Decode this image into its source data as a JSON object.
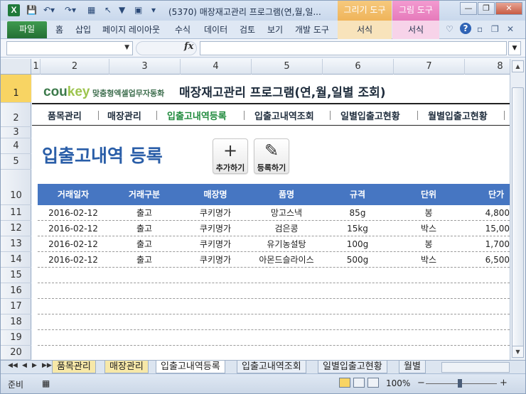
{
  "window": {
    "title": "(5370) 매장재고관리 프로그램(연,월,일...",
    "context_tools": [
      "그리기 도구",
      "그림 도구"
    ]
  },
  "ribbon": {
    "file_tab": "파일",
    "tabs": [
      "홈",
      "삽입",
      "페이지 레이아웃",
      "수식",
      "데이터",
      "검토",
      "보기",
      "개발 도구"
    ],
    "context_tabs": [
      "서식",
      "서식"
    ]
  },
  "formula_bar": {
    "fx_label": "fx",
    "name_box": "",
    "formula": ""
  },
  "columns": [
    "1",
    "2",
    "3",
    "4",
    "5",
    "6",
    "7",
    "8"
  ],
  "rows": [
    "1",
    "2",
    "3",
    "4",
    "5",
    "10",
    "11",
    "12",
    "13",
    "14",
    "15",
    "16",
    "17",
    "18",
    "19",
    "20"
  ],
  "sheet": {
    "brand": {
      "name_a": "cou",
      "name_b": "key",
      "subtitle": "맞춤형엑셀업무자동화"
    },
    "app_title": "매장재고관리 프로그램(연,월,일별 조회)",
    "menu": [
      "품목관리",
      "매장관리",
      "입출고내역등록",
      "입출고내역조회",
      "일별입출고현황",
      "월별입출고현황"
    ],
    "active_menu_index": 2,
    "page_title": "입출고내역 등록",
    "buttons": {
      "add": "추가하기",
      "register": "등록하기"
    },
    "table": {
      "headers": [
        "거래일자",
        "거래구분",
        "매장명",
        "품명",
        "규격",
        "단위",
        "단가"
      ],
      "rows": [
        [
          "2016-02-12",
          "출고",
          "쿠키명가",
          "망고스낵",
          "85g",
          "봉",
          "4,800"
        ],
        [
          "2016-02-12",
          "출고",
          "쿠키명가",
          "검은콩",
          "15kg",
          "박스",
          "15,00"
        ],
        [
          "2016-02-12",
          "출고",
          "쿠키명가",
          "유기농설탕",
          "100g",
          "봉",
          "1,700"
        ],
        [
          "2016-02-12",
          "출고",
          "쿠키명가",
          "아몬드슬라이스",
          "500g",
          "박스",
          "6,500"
        ]
      ]
    }
  },
  "sheet_tabs": [
    "품목관리",
    "매장관리",
    "입출고내역등록",
    "입출고내역조회",
    "일별입출고현황",
    "월별"
  ],
  "status": {
    "ready": "준비",
    "zoom": "100%"
  },
  "colors": {
    "header_blue": "#4676c2",
    "title_blue": "#2a5ea8",
    "active_menu": "#1f8a3c",
    "excel_green": "#236f34"
  }
}
